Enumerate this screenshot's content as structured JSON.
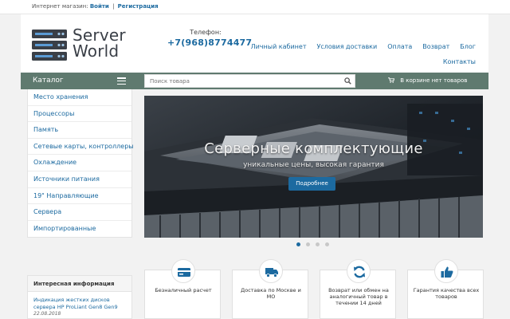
{
  "topbar": {
    "prefix": "Интернет магазин:",
    "login": "Войти",
    "separator": "|",
    "register": "Регистрация"
  },
  "logo": {
    "line1": "Server",
    "line2": "World"
  },
  "contact": {
    "phone_label": "Телефон:",
    "phone_number": "+7(968)8774477"
  },
  "nav": {
    "items": [
      "Личный кабинет",
      "Условия доставки",
      "Оплата",
      "Возврат",
      "Блог"
    ],
    "contacts": "Контакты"
  },
  "catalog_bar": {
    "catalog_label": "Каталог",
    "search_placeholder": "Поиск товара",
    "cart_text": "В корзине нет товаров"
  },
  "sidebar": {
    "items": [
      "Место хранения",
      "Процессоры",
      "Память",
      "Сетевые карты, контроллеры",
      "Охлаждение",
      "Источники питания",
      "19\" Направляющие",
      "Сервера",
      "Импортированные"
    ]
  },
  "banner": {
    "title": "Серверные комплектующие",
    "subtitle": "уникальные цены, высокая гарантия",
    "button": "Подробнее",
    "active_slide": 1,
    "slide_count": 4
  },
  "info": {
    "title": "Интересная информация",
    "link": "Индикация жестких дисков сервера HP ProLiant Gen8 Gen9",
    "date": "22.08.2018"
  },
  "features": [
    {
      "icon": "credit-card-icon",
      "text": "Безналичный расчет"
    },
    {
      "icon": "truck-icon",
      "text": "Доставка по Москве и МО"
    },
    {
      "icon": "refresh-icon",
      "text": "Возврат или обмен на аналогичный товар в течении 14 дней"
    },
    {
      "icon": "thumbs-up-icon",
      "text": "Гарантия качества всех товаров"
    }
  ],
  "colors": {
    "accent": "#1c6aa0",
    "bar": "#5f7a6f"
  }
}
